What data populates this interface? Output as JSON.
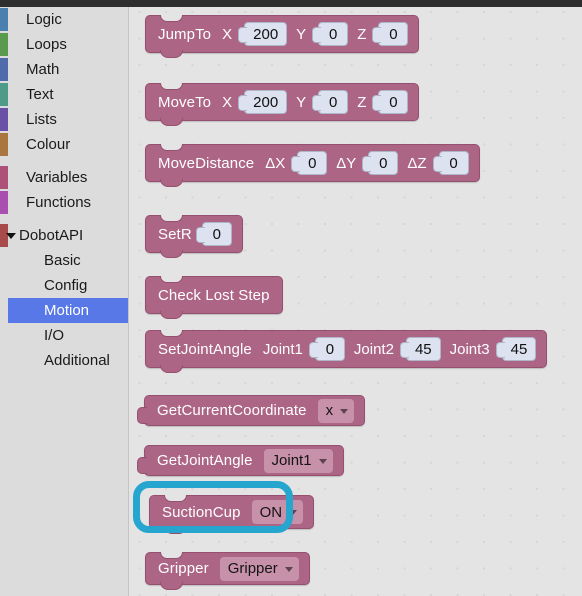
{
  "toolbox": {
    "categories": [
      {
        "label": "Logic",
        "color": "#4a7fae",
        "icon": "category-swatch"
      },
      {
        "label": "Loops",
        "color": "#5a9a4e",
        "icon": "category-swatch"
      },
      {
        "label": "Math",
        "color": "#4f6bab",
        "icon": "category-swatch"
      },
      {
        "label": "Text",
        "color": "#4f9b8a",
        "icon": "category-swatch"
      },
      {
        "label": "Lists",
        "color": "#6b50a8",
        "icon": "category-swatch"
      },
      {
        "label": "Colour",
        "color": "#a9763f",
        "icon": "category-swatch"
      }
    ],
    "groups": [
      {
        "label": "Variables",
        "color": "#ad5178",
        "icon": "category-swatch"
      },
      {
        "label": "Functions",
        "color": "#a84fb0",
        "icon": "category-swatch"
      }
    ],
    "tree": {
      "label": "DobotAPI",
      "color": "#a84b4b",
      "expander_icon": "triangle-down-icon",
      "expanded": true,
      "children": [
        {
          "label": "Basic",
          "selected": false
        },
        {
          "label": "Config",
          "selected": false
        },
        {
          "label": "Motion",
          "selected": true
        },
        {
          "label": "I/O",
          "selected": false
        },
        {
          "label": "Additional",
          "selected": false
        }
      ]
    },
    "selected_color": "#5878e8"
  },
  "flyout": {
    "block_color": "#ad6585",
    "blocks": [
      {
        "name": "jump-to",
        "label": "JumpTo",
        "kind": "statement",
        "args": [
          {
            "label": "X",
            "type": "number",
            "value": "200"
          },
          {
            "label": "Y",
            "type": "number",
            "value": "0"
          },
          {
            "label": "Z",
            "type": "number",
            "value": "0"
          }
        ]
      },
      {
        "name": "move-to",
        "label": "MoveTo",
        "kind": "statement",
        "args": [
          {
            "label": "X",
            "type": "number",
            "value": "200"
          },
          {
            "label": "Y",
            "type": "number",
            "value": "0"
          },
          {
            "label": "Z",
            "type": "number",
            "value": "0"
          }
        ]
      },
      {
        "name": "move-distance",
        "label": "MoveDistance",
        "kind": "statement",
        "args": [
          {
            "label": "ΔX",
            "type": "number",
            "value": "0"
          },
          {
            "label": "ΔY",
            "type": "number",
            "value": "0"
          },
          {
            "label": "ΔZ",
            "type": "number",
            "value": "0"
          }
        ]
      },
      {
        "name": "set-r",
        "label": "SetR",
        "kind": "statement",
        "args": [
          {
            "label": "",
            "type": "number",
            "value": "0"
          }
        ]
      },
      {
        "name": "check-lost-step",
        "label": "Check Lost Step",
        "kind": "statement",
        "args": []
      },
      {
        "name": "set-joint-angle",
        "label": "SetJointAngle",
        "kind": "statement",
        "args": [
          {
            "label": "Joint1",
            "type": "number",
            "value": "0"
          },
          {
            "label": "Joint2",
            "type": "number",
            "value": "45"
          },
          {
            "label": "Joint3",
            "type": "number",
            "value": "45"
          }
        ]
      },
      {
        "name": "get-current-coordinate",
        "label": "GetCurrentCoordinate",
        "kind": "value",
        "args": [
          {
            "label": "",
            "type": "dropdown",
            "value": "x"
          }
        ]
      },
      {
        "name": "get-joint-angle",
        "label": "GetJointAngle",
        "kind": "value",
        "args": [
          {
            "label": "",
            "type": "dropdown",
            "value": "Joint1"
          }
        ]
      },
      {
        "name": "suction-cup",
        "label": "SuctionCup",
        "kind": "statement",
        "highlighted": true,
        "args": [
          {
            "label": "",
            "type": "dropdown",
            "value": "ON"
          }
        ]
      },
      {
        "name": "gripper",
        "label": "Gripper",
        "kind": "statement",
        "args": [
          {
            "label": "",
            "type": "dropdown",
            "value": "Gripper"
          }
        ]
      }
    ]
  },
  "annotation": {
    "name": "suction-cup-highlight",
    "shape": "rounded-rectangle-outline",
    "color": "#26a5cf"
  }
}
